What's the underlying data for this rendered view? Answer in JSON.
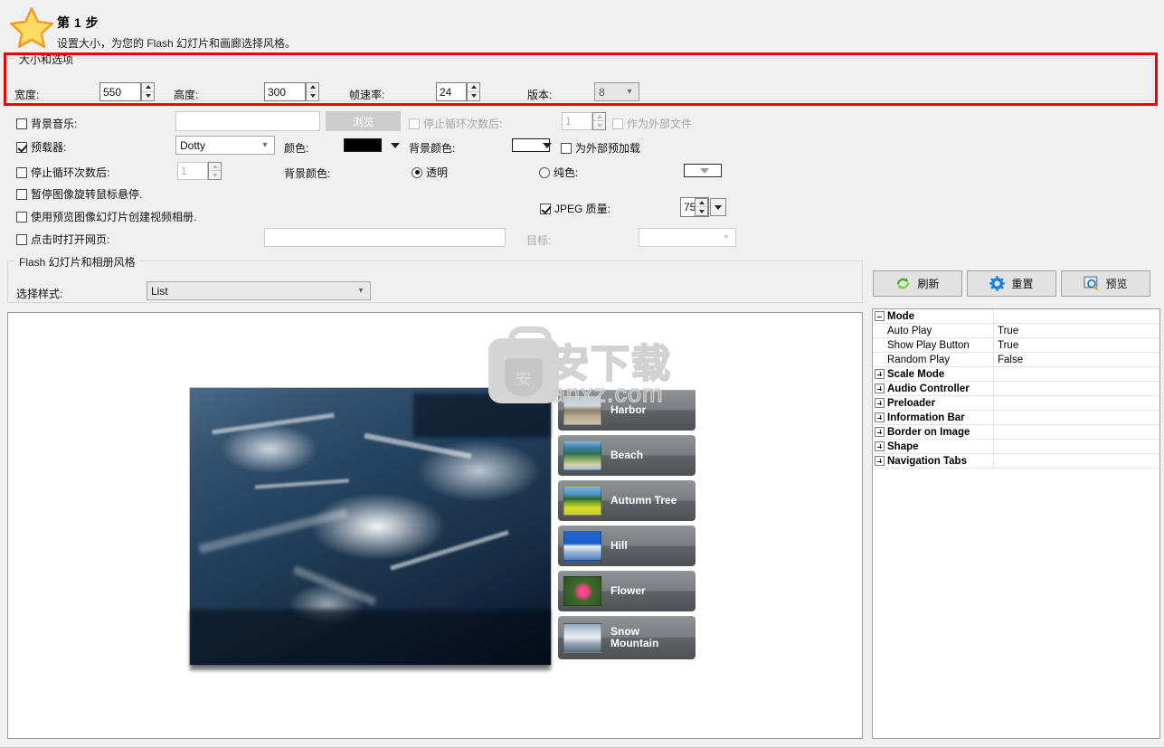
{
  "header": {
    "step_title": "第 1 步",
    "subtitle": "设置大小，为您的 Flash 幻灯片和画廊选择风格。",
    "star_icon": "star-icon"
  },
  "size_group": {
    "title": "大小和选项",
    "width_label": "宽度:",
    "width_value": "550",
    "height_label": "高度:",
    "height_value": "300",
    "framerate_label": "帧速率:",
    "framerate_value": "24",
    "version_label": "版本:",
    "version_value": "8",
    "highlight_color": "#ee0000"
  },
  "options": {
    "bgmusic_label": "背景音乐:",
    "bgmusic_value": "",
    "browse_label": "浏览",
    "stop_after_loops_label_1": "停止循环次数后:",
    "stop_after_loops_value_1": "1",
    "external_file_label": "作为外部文件",
    "preloader_label": "预载器:",
    "preloader_value": "Dotty",
    "color_label": "颜色:",
    "color_value": "#000000",
    "bgcolor_label": "背景颜色:",
    "bgcolor_value": "#ffffff",
    "preload_external_label": "为外部预加载",
    "stop_after_loops_label_2": "停止循环次数后:",
    "stop_after_loops_value_2": "1",
    "bgcolor_label_2": "背景颜色:",
    "transparent_label": "透明",
    "solid_label": "纯色:",
    "solid_color_value": "#ffffff",
    "pause_rotation_label": "暂停图像旋转鼠标悬停.",
    "create_video_label": "使用预览图像幻灯片创建视频相册.",
    "jpeg_quality_label": "JPEG 质量:",
    "jpeg_quality_value": "75",
    "open_url_label": "点击时打开网页:",
    "open_url_value": "",
    "target_label": "目标:",
    "target_value": ""
  },
  "style_group": {
    "title": "Flash 幻灯片和相册风格",
    "select_style_label": "选择样式:",
    "select_style_value": "List"
  },
  "action_buttons": [
    {
      "label": "刷新",
      "icon": "refresh-icon"
    },
    {
      "label": "重置",
      "icon": "gear-icon"
    },
    {
      "label": "预览",
      "icon": "magnifier-icon"
    }
  ],
  "preview": {
    "thumbnails": [
      {
        "label": "Harbor",
        "art": "pic-harbor"
      },
      {
        "label": "Beach",
        "art": "pic-beach"
      },
      {
        "label": "Autumn Tree",
        "art": "pic-autumn"
      },
      {
        "label": "Hill",
        "art": "pic-hill"
      },
      {
        "label": "Flower",
        "art": "pic-flower"
      },
      {
        "label": "Snow Mountain",
        "art": "pic-snow"
      }
    ],
    "watermark_cn": "安下载",
    "watermark_en": "anxz.com",
    "watermark_glyph": "安"
  },
  "property_grid": {
    "rows": [
      {
        "kind": "category",
        "expander": "minus",
        "name": "Mode",
        "value": ""
      },
      {
        "kind": "item",
        "name": "Auto Play",
        "value": "True"
      },
      {
        "kind": "item",
        "name": "Show Play Button",
        "value": "True"
      },
      {
        "kind": "item",
        "name": "Random Play",
        "value": "False"
      },
      {
        "kind": "category",
        "expander": "plus",
        "name": "Scale Mode",
        "value": ""
      },
      {
        "kind": "category",
        "expander": "plus",
        "name": "Audio Controller",
        "value": ""
      },
      {
        "kind": "category",
        "expander": "plus",
        "name": "Preloader",
        "value": ""
      },
      {
        "kind": "category",
        "expander": "plus",
        "name": "Information Bar",
        "value": ""
      },
      {
        "kind": "category",
        "expander": "plus",
        "name": "Border on Image",
        "value": ""
      },
      {
        "kind": "category",
        "expander": "plus",
        "name": "Shape",
        "value": ""
      },
      {
        "kind": "category",
        "expander": "plus",
        "name": "Navigation Tabs",
        "value": ""
      }
    ]
  }
}
